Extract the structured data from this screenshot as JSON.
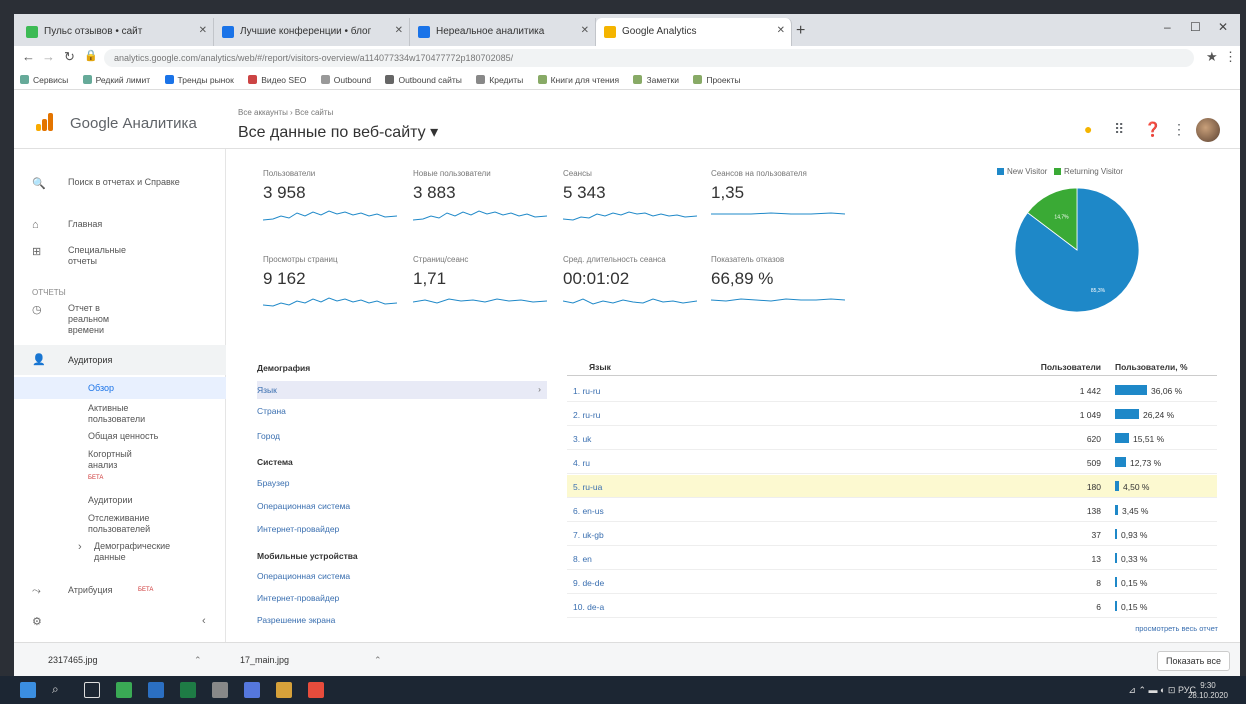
{
  "browser": {
    "tabs": [
      {
        "label": "Пульс отзывов • сайт",
        "fav": "#3cba54"
      },
      {
        "label": "Лучшие конференции • блог",
        "fav": "#1a73e8"
      },
      {
        "label": "Нереальное аналитика",
        "fav": "#1a73e8"
      },
      {
        "label": "Google Analytics",
        "fav": "#f4b400"
      }
    ],
    "new_tab": "+",
    "minimize": "–",
    "maximize": "☐",
    "close": "✕",
    "url": "analytics.google.com/analytics/web/#/report/visitors-overview/a114077334w170477772p180702085/",
    "bookmarks": [
      "Сервисы",
      "Редкий лимит",
      "Тренды рынок",
      "Видео SEO",
      "Outbound",
      "Outbound сайты",
      "Кредиты",
      "Книги для чтения",
      "Заметки",
      "Проекты"
    ]
  },
  "ga": {
    "brand": "Google Аналитика",
    "breadcrumbs": "Все аккаунты › Все сайты",
    "view": "Все данные по веб-сайту",
    "view_caret": "▾"
  },
  "sidebar": {
    "search": "Поиск в отчетах и Справке",
    "home": "Главная",
    "custom": "Специальные отчеты",
    "reports_header": "ОТЧЕТЫ",
    "realtime": "Отчет в реальном времени",
    "audience": "Аудитория",
    "overview": "Обзор",
    "active_users": "Активные пользователи",
    "lifetime": "Общая ценность",
    "cohort": "Когортный анализ",
    "cohort_badge": "БЕТА",
    "audiences": "Аудитории",
    "user_explorer": "Отслеживание пользователей",
    "demographics": "Демографические данные",
    "attribution": "Атрибуция",
    "attribution_badge": "БЕТА"
  },
  "metrics": [
    {
      "name": "Пользователи",
      "value": "3 958"
    },
    {
      "name": "Новые пользователи",
      "value": "3 883"
    },
    {
      "name": "Сеансы",
      "value": "5 343"
    },
    {
      "name": "Сеансов на пользователя",
      "value": "1,35"
    },
    {
      "name": "Просмотры страниц",
      "value": "9 162"
    },
    {
      "name": "Страниц/сеанс",
      "value": "1,71"
    },
    {
      "name": "Сред. длительность сеанса",
      "value": "00:01:02"
    },
    {
      "name": "Показатель отказов",
      "value": "66,89 %"
    }
  ],
  "pie": {
    "legend": [
      "New Visitor",
      "Returning Visitor"
    ],
    "colors": [
      "#1e88c8",
      "#3aaa35"
    ],
    "values": [
      85.3,
      14.7
    ],
    "labels": [
      "85,3%",
      "14,7%"
    ]
  },
  "demographics": {
    "header": "Демография",
    "language": "Язык",
    "country": "Страна",
    "city": "Город",
    "system_header": "Система",
    "browser": "Браузер",
    "os": "Операционная система",
    "provider": "Интернет-провайдер",
    "mobile_header": "Мобильные устройства",
    "m_os": "Операционная система",
    "m_provider": "Интернет-провайдер",
    "m_resolution": "Разрешение экрана"
  },
  "table": {
    "col_lang": "Язык",
    "col_users": "Пользователи",
    "col_pct": "Пользователи, %",
    "rows": [
      {
        "lang": "1. ru-ru",
        "users": "1 442",
        "pct": "36,06 %",
        "frac": 0.3606
      },
      {
        "lang": "2. ru-ru",
        "users": "1 049",
        "pct": "26,24 %",
        "frac": 0.2624
      },
      {
        "lang": "3. uk",
        "users": "620",
        "pct": "15,51 %",
        "frac": 0.1551
      },
      {
        "lang": "4. ru",
        "users": "509",
        "pct": "12,73 %",
        "frac": 0.1273
      },
      {
        "lang": "5. ru-ua",
        "users": "180",
        "pct": "4,50 %",
        "frac": 0.045
      },
      {
        "lang": "6. en-us",
        "users": "138",
        "pct": "3,45 %",
        "frac": 0.0345
      },
      {
        "lang": "7. uk-gb",
        "users": "37",
        "pct": "0,93 %",
        "frac": 0.0093
      },
      {
        "lang": "8. en",
        "users": "13",
        "pct": "0,33 %",
        "frac": 0.0033
      },
      {
        "lang": "9. de-de",
        "users": "8",
        "pct": "0,15 %",
        "frac": 0.0015
      },
      {
        "lang": "10. de-a",
        "users": "6",
        "pct": "0,15 %",
        "frac": 0.0015
      }
    ],
    "full_report": "просмотреть весь отчет"
  },
  "downloads": {
    "file1": "2317465.jpg",
    "file2": "17_main.jpg",
    "show_all": "Показать все",
    "close": "✕"
  },
  "taskbar": {
    "tray": "⊿ ⌃ ▬ ◐ ⊡ РУС",
    "time": "9:30",
    "date": "28.10.2020"
  }
}
